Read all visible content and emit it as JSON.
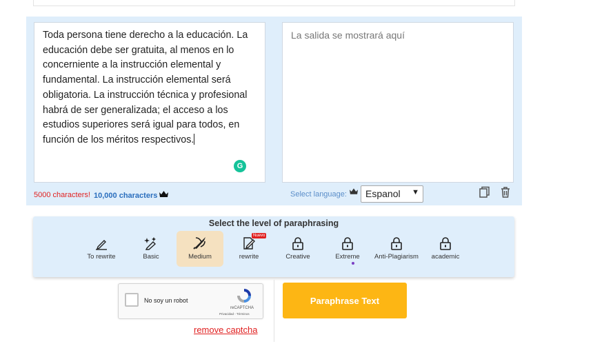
{
  "input": {
    "text": "Toda persona tiene derecho a la educación. La educación debe ser gratuita, al menos en lo concerniente a la instrucción elemental y fundamental. La instrucción elemental será obligatoria. La instrucción técnica y profesional habrá de ser generalizada; el acceso a los estudios superiores será igual para todos, en función de los méritos respectivos."
  },
  "output": {
    "placeholder": "La salida se mostrará aquí"
  },
  "limits": {
    "free": "5000 characters!",
    "premium": "10,000 characters"
  },
  "language": {
    "label": "Select language:",
    "selected": "Espanol"
  },
  "levels": {
    "title": "Select the level of paraphrasing",
    "new_badge": "Nuevo",
    "options": [
      {
        "label": "To rewrite",
        "icon": "pen-underline-icon"
      },
      {
        "label": "Basic",
        "icon": "sparkle-pen-icon"
      },
      {
        "label": "Medium",
        "icon": "rocket-pen-icon",
        "active": true
      },
      {
        "label": "rewrite",
        "icon": "paper-pen-icon"
      },
      {
        "label": "Creative",
        "icon": "lock-icon"
      },
      {
        "label": "Extreme",
        "icon": "lock-icon"
      },
      {
        "label": "Anti-Plagiarism",
        "icon": "lock-icon"
      },
      {
        "label": "academic",
        "icon": "lock-icon"
      }
    ]
  },
  "captcha": {
    "label": "No soy un robot",
    "brand": "reCAPTCHA",
    "terms": "Privacidad - Términos"
  },
  "remove_captcha": "remove captcha",
  "paraphrase_button": "Paraphrase Text",
  "colors": {
    "accent": "#fdb614",
    "panel": "#dfeefb",
    "limit": "#e02020",
    "premium": "#2a6ebd"
  }
}
